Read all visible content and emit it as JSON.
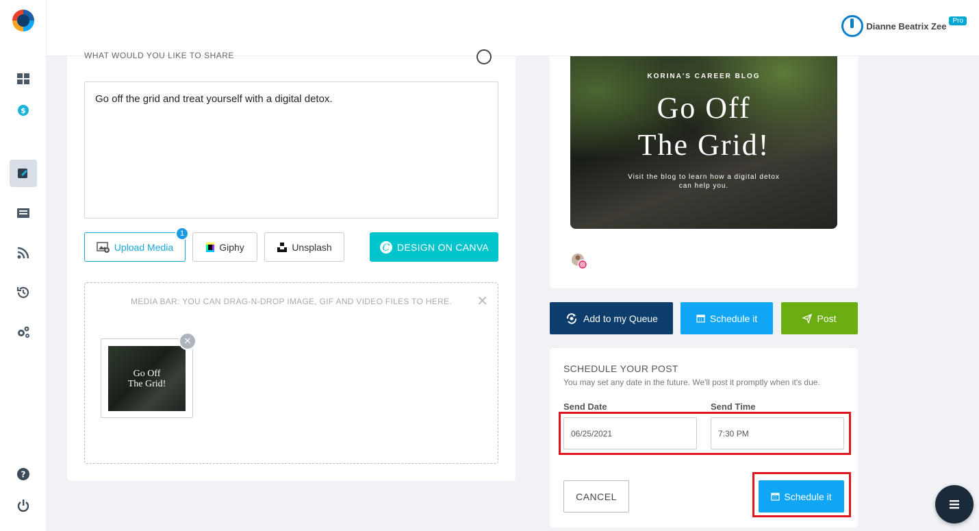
{
  "user": {
    "name": "Dianne Beatrix Zee",
    "badge": "Pro"
  },
  "composer": {
    "heading": "WHAT WOULD YOU LIKE TO SHARE",
    "text": "Go off the grid and treat yourself with a digital detox.",
    "buttons": {
      "upload": "Upload Media",
      "upload_count": "1",
      "giphy": "Giphy",
      "unsplash": "Unsplash",
      "canva": "DESIGN ON CANVA"
    },
    "mediabar_hint": "MEDIA BAR: YOU CAN DRAG-N-DROP IMAGE, GIF AND VIDEO FILES TO HERE.",
    "thumb": {
      "line1": "Go Off",
      "line2": "The Grid!"
    }
  },
  "preview": {
    "brand": "KORINA'S CAREER BLOG",
    "title_line1": "Go Off",
    "title_line2": "The Grid!",
    "subtitle": "Visit the blog to learn how a digital detox can help you."
  },
  "actions": {
    "queue": "Add to my Queue",
    "schedule": "Schedule it",
    "post": "Post"
  },
  "schedule": {
    "title": "SCHEDULE YOUR POST",
    "subtitle": "You may set any date in the future. We'll post it promptly when it's due.",
    "date_label": "Send Date",
    "date_value": "06/25/2021",
    "time_label": "Send Time",
    "time_value": "7:30 PM",
    "cancel": "CANCEL",
    "submit": "Schedule it"
  },
  "colors": {
    "accent": "#11a6f5",
    "queue": "#0d3d6b",
    "post": "#6aae12",
    "canva": "#00c4cc",
    "highlight": "#e0121b"
  },
  "icons": [
    "logo-icon",
    "dashboard-icon",
    "billing-icon",
    "compose-icon",
    "posts-icon",
    "rss-icon",
    "history-icon",
    "settings-icon",
    "help-icon",
    "power-icon",
    "emoji-icon",
    "menu-icon"
  ]
}
